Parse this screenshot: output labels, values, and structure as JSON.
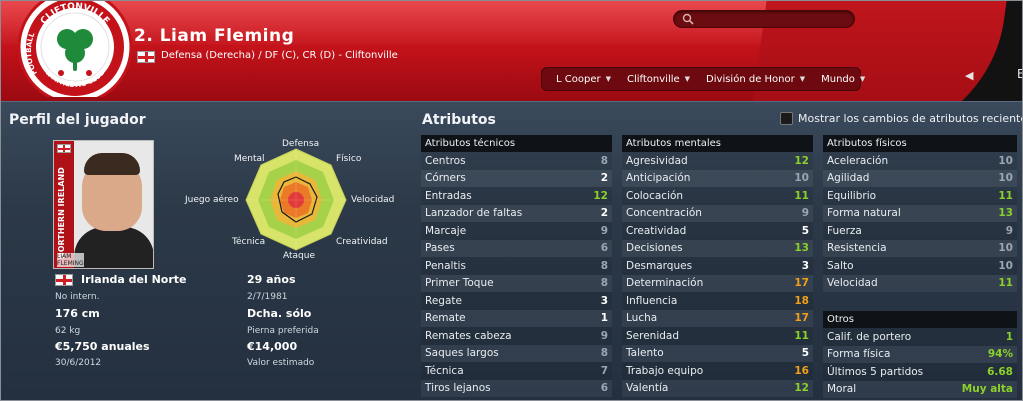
{
  "header": {
    "title": "2. Liam Fleming",
    "position_line": "Defensa (Derecha) / DF (C), CR (D) - Cliftonville",
    "search_placeholder": "",
    "nav": [
      {
        "label": "L Cooper"
      },
      {
        "label": "Cliftonville"
      },
      {
        "label": "División de Honor"
      },
      {
        "label": "Mundo"
      }
    ],
    "back_icon": "triangle-left",
    "forward_partial": "E"
  },
  "crest": {
    "top_text": "CLIFTONVILLE",
    "left_text": "FOOTBALL",
    "bottom_text": "& ATHLETIC CLUB",
    "colors": {
      "red": "#c4121a",
      "green": "#1e8a3a"
    }
  },
  "profile": {
    "title": "Perfil del jugador",
    "photo_strip_text": "NORTHERN IRELAND",
    "photo_caption_1": "LIAM",
    "photo_caption_2": "FLEMING",
    "nationality": "Irlanda del Norte",
    "caps": "No intern.",
    "height": "176 cm",
    "weight": "62 kg",
    "wage": "€5,750 anuales",
    "contract_end": "30/6/2012",
    "age": "29 años",
    "dob": "2/7/1981",
    "foot": "Dcha. sólo",
    "foot_label": "Pierna preferida",
    "value": "€14,000",
    "value_label": "Valor estimado"
  },
  "radar": {
    "labels": {
      "defensa": "Defensa",
      "fisico": "Físico",
      "velocidad": "Velocidad",
      "creatividad": "Creatividad",
      "ataque": "Ataque",
      "tecnica": "Técnica",
      "juego_aereo": "Juego aéreo",
      "mental": "Mental"
    }
  },
  "attributes": {
    "title": "Atributos",
    "show_changes_label": "Mostrar los cambios de atributos recientes",
    "technical": {
      "header": "Atributos técnicos",
      "rows": [
        {
          "name": "Centros",
          "value": "8",
          "tone": "grey"
        },
        {
          "name": "Córners",
          "value": "2",
          "tone": "white"
        },
        {
          "name": "Entradas",
          "value": "12",
          "tone": "green"
        },
        {
          "name": "Lanzador de faltas",
          "value": "2",
          "tone": "white"
        },
        {
          "name": "Marcaje",
          "value": "9",
          "tone": "grey"
        },
        {
          "name": "Pases",
          "value": "6",
          "tone": "grey"
        },
        {
          "name": "Penaltis",
          "value": "8",
          "tone": "grey"
        },
        {
          "name": "Primer Toque",
          "value": "8",
          "tone": "grey"
        },
        {
          "name": "Regate",
          "value": "3",
          "tone": "white"
        },
        {
          "name": "Remate",
          "value": "1",
          "tone": "white"
        },
        {
          "name": "Remates cabeza",
          "value": "9",
          "tone": "grey"
        },
        {
          "name": "Saques largos",
          "value": "8",
          "tone": "grey"
        },
        {
          "name": "Técnica",
          "value": "7",
          "tone": "grey"
        },
        {
          "name": "Tiros lejanos",
          "value": "6",
          "tone": "grey"
        }
      ]
    },
    "mental": {
      "header": "Atributos mentales",
      "rows": [
        {
          "name": "Agresividad",
          "value": "12",
          "tone": "green"
        },
        {
          "name": "Anticipación",
          "value": "10",
          "tone": "grey"
        },
        {
          "name": "Colocación",
          "value": "11",
          "tone": "green"
        },
        {
          "name": "Concentración",
          "value": "9",
          "tone": "grey"
        },
        {
          "name": "Creatividad",
          "value": "5",
          "tone": "white"
        },
        {
          "name": "Decisiones",
          "value": "13",
          "tone": "green"
        },
        {
          "name": "Desmarques",
          "value": "3",
          "tone": "white"
        },
        {
          "name": "Determinación",
          "value": "17",
          "tone": "orange"
        },
        {
          "name": "Influencia",
          "value": "18",
          "tone": "orange"
        },
        {
          "name": "Lucha",
          "value": "17",
          "tone": "orange"
        },
        {
          "name": "Serenidad",
          "value": "11",
          "tone": "green"
        },
        {
          "name": "Talento",
          "value": "5",
          "tone": "white"
        },
        {
          "name": "Trabajo equipo",
          "value": "16",
          "tone": "orange"
        },
        {
          "name": "Valentía",
          "value": "12",
          "tone": "green"
        }
      ]
    },
    "physical": {
      "header": "Atributos físicos",
      "rows": [
        {
          "name": "Aceleración",
          "value": "10",
          "tone": "grey"
        },
        {
          "name": "Agilidad",
          "value": "10",
          "tone": "grey"
        },
        {
          "name": "Equilibrio",
          "value": "11",
          "tone": "green"
        },
        {
          "name": "Forma natural",
          "value": "13",
          "tone": "green"
        },
        {
          "name": "Fuerza",
          "value": "9",
          "tone": "grey"
        },
        {
          "name": "Resistencia",
          "value": "10",
          "tone": "grey"
        },
        {
          "name": "Salto",
          "value": "10",
          "tone": "grey"
        },
        {
          "name": "Velocidad",
          "value": "11",
          "tone": "green"
        }
      ]
    },
    "other": {
      "header": "Otros",
      "rows": [
        {
          "name": "Calif. de portero",
          "value": "1",
          "tone": "green"
        },
        {
          "name": "Forma física",
          "value": "94%",
          "tone": "green"
        },
        {
          "name": "Últimos 5 partidos",
          "value": "6.68",
          "tone": "green"
        },
        {
          "name": "Moral",
          "value": "Muy alta",
          "tone": "green"
        }
      ]
    }
  },
  "colors": {
    "header_red": "#c4121a",
    "panel_dark": "#27313c",
    "value_green": "#8bd12a",
    "value_orange": "#f0a018"
  }
}
